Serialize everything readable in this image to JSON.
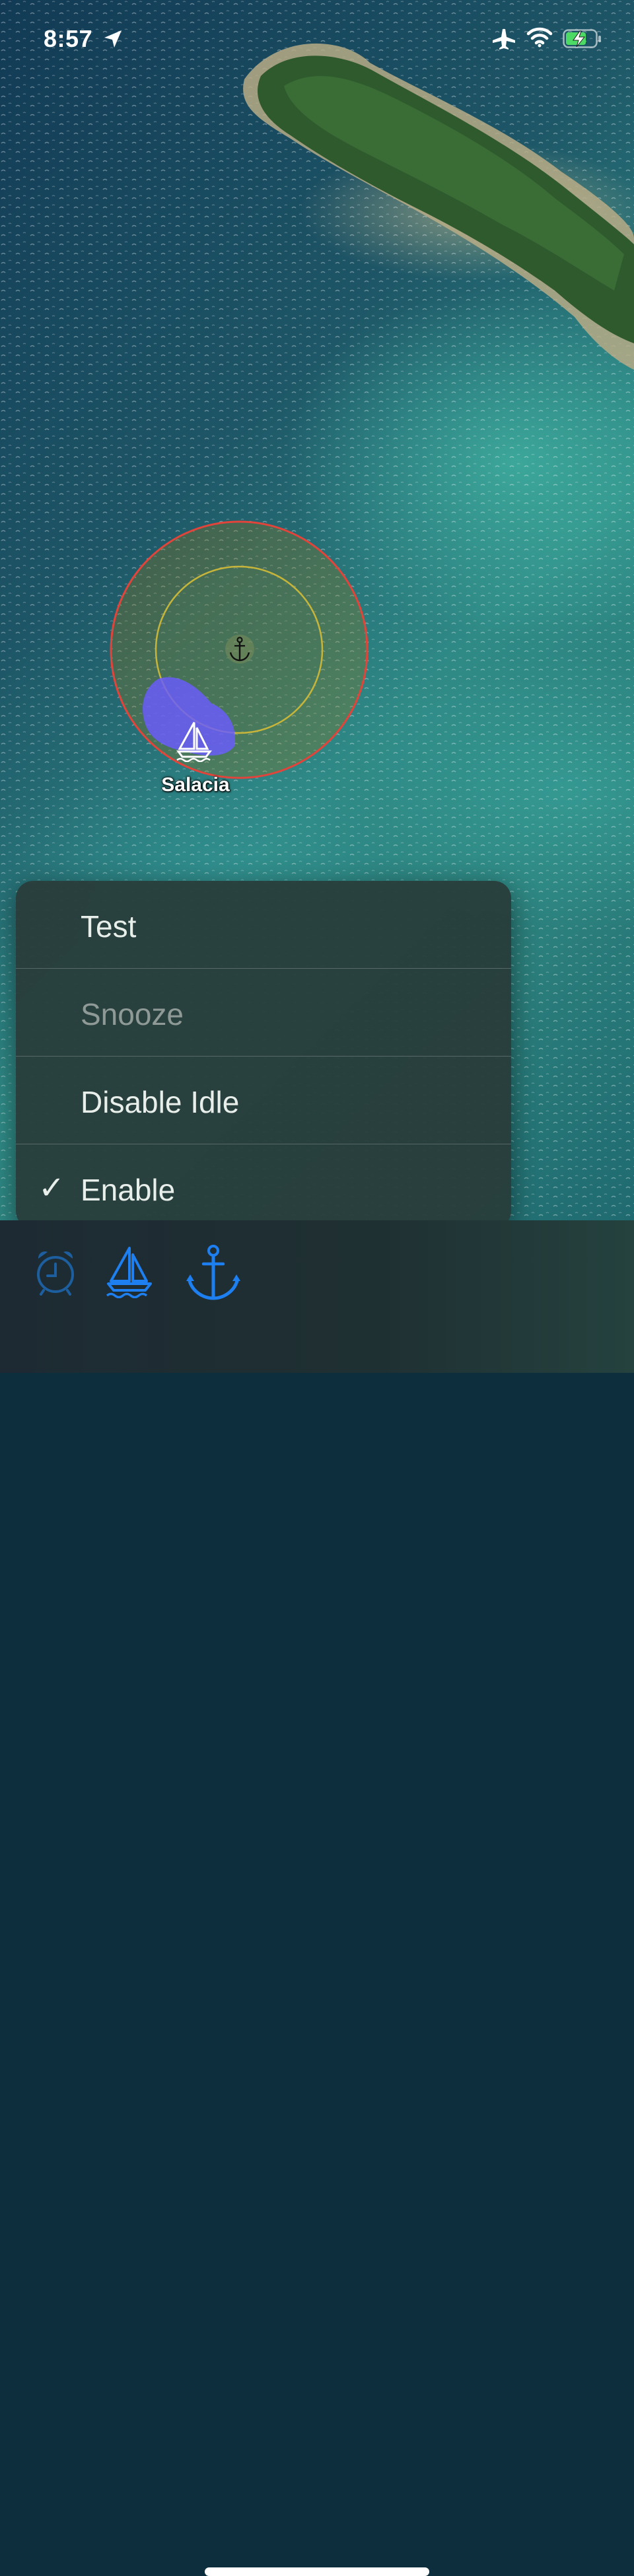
{
  "status_bar": {
    "time": "8:57",
    "icons": [
      "location-arrow-icon",
      "airplane-mode-icon",
      "wifi-icon",
      "battery-charging-icon"
    ],
    "battery_color": "#4cd964"
  },
  "map": {
    "boat_name": "Salacia",
    "icons": [
      "anchor-icon",
      "sailboat-icon"
    ],
    "colors": {
      "alarm_ring": "#e0443a",
      "inner_ring": "#c6b53a",
      "boat_track": "#6a5cff"
    }
  },
  "menu": {
    "items": [
      {
        "label": "Test",
        "checked": false,
        "disabled": false
      },
      {
        "label": "Snooze",
        "checked": false,
        "disabled": true
      },
      {
        "label": "Disable Idle",
        "checked": false,
        "disabled": false
      },
      {
        "label": "Enable",
        "checked": true,
        "disabled": false
      }
    ],
    "check_glyph": "✓"
  },
  "toolbar": {
    "buttons": [
      "alarm-clock-icon",
      "sailboat-icon",
      "anchor-icon"
    ],
    "accent": "#1e7ff0",
    "dimmed": "#1d5f9e"
  }
}
